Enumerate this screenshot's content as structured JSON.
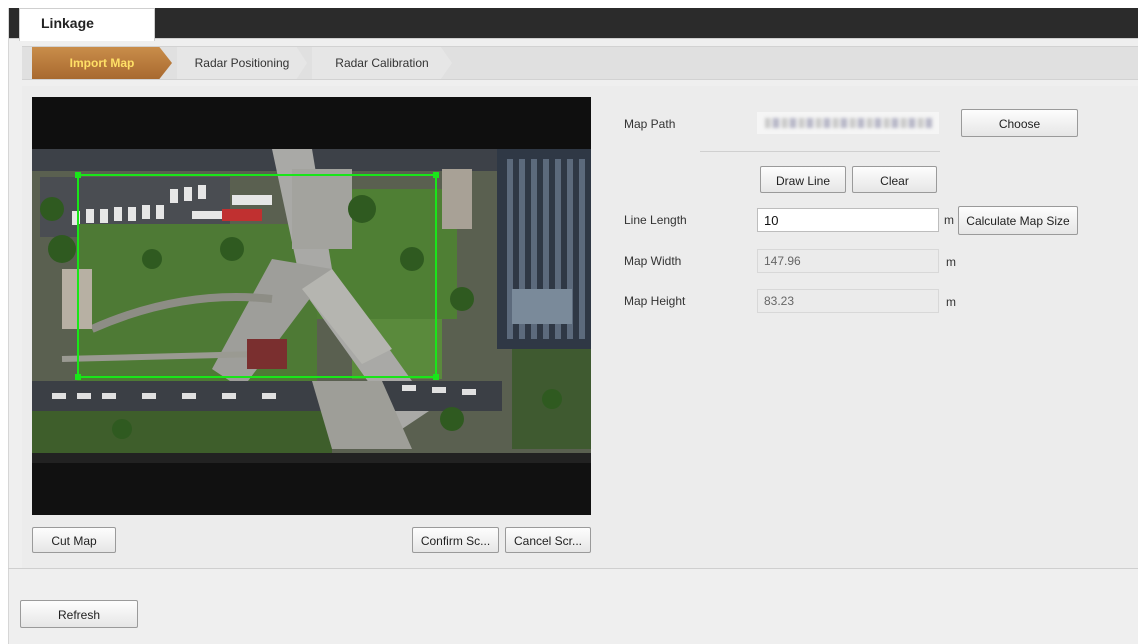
{
  "window": {
    "tab_title": "Linkage"
  },
  "subtabs": [
    {
      "label": "Import Map",
      "active": true
    },
    {
      "label": "Radar Positioning",
      "active": false
    },
    {
      "label": "Radar Calibration",
      "active": false
    }
  ],
  "map_buttons": {
    "cut_map": "Cut Map",
    "confirm_screenshot": "Confirm Sc...",
    "cancel_screenshot": "Cancel Scr..."
  },
  "form": {
    "map_path_label": "Map Path",
    "choose_button": "Choose",
    "draw_line_button": "Draw Line",
    "clear_button": "Clear",
    "line_length_label": "Line Length",
    "line_length_value": "10",
    "line_length_unit": "m",
    "calculate_button": "Calculate Map Size",
    "map_width_label": "Map Width",
    "map_width_value": "147.96",
    "map_width_unit": "m",
    "map_height_label": "Map Height",
    "map_height_value": "83.23",
    "map_height_unit": "m"
  },
  "footer": {
    "refresh_button": "Refresh"
  },
  "colors": {
    "active_tab_text": "#ffe066",
    "active_tab_bg": "#b9793b",
    "selection_rect": "#19e619"
  }
}
